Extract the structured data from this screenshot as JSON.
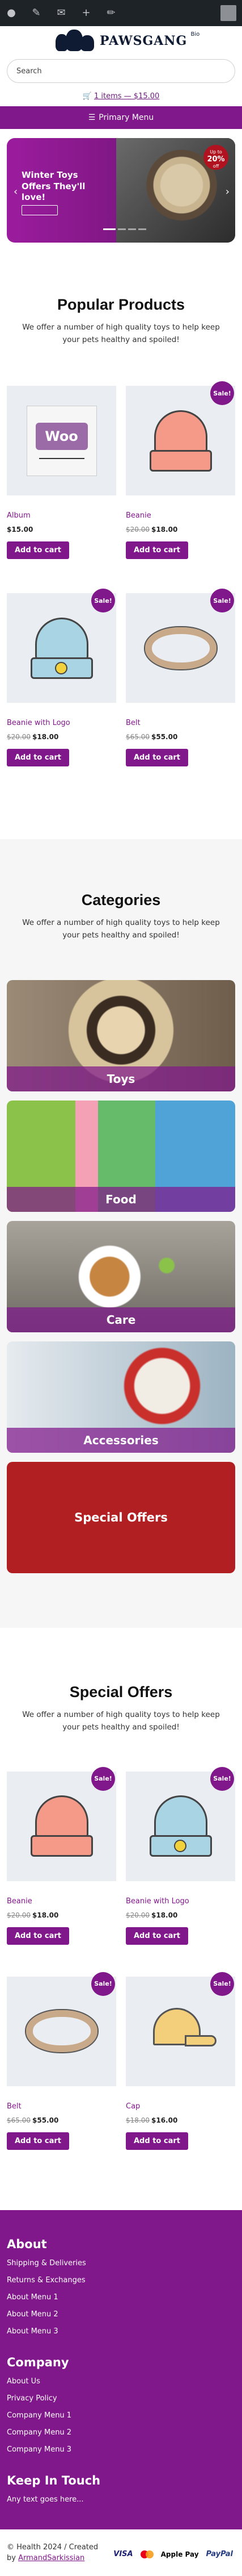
{
  "admin_bar": {
    "icons": [
      "wordpress-icon",
      "paint-brush-icon",
      "comment-icon",
      "plus-icon",
      "pencil-icon"
    ]
  },
  "header": {
    "site_name": "PAWSGANG",
    "site_name_sup": "Bio",
    "search_placeholder": "Search",
    "cart_text": "1 items — $15.00",
    "menu_label": "Primary Menu"
  },
  "hero": {
    "title": "Winter Toys Offers They'll love!",
    "badge_top": "Up to",
    "badge_pct": "20%",
    "badge_bottom": "off"
  },
  "popular": {
    "heading": "Popular Products",
    "lead": "We offer a number of high quality toys to help keep your pets healthy and spoiled!",
    "products": [
      {
        "name": "Album",
        "price": "$15.00",
        "old_price": "",
        "sale": false,
        "button": "Add to cart",
        "image": "woo-album"
      },
      {
        "name": "Beanie",
        "price": "$18.00",
        "old_price": "$20.00",
        "sale": true,
        "button": "Add to cart",
        "image": "beanie-orange"
      },
      {
        "name": "Beanie with Logo",
        "price": "$18.00",
        "old_price": "$20.00",
        "sale": true,
        "button": "Add to cart",
        "image": "beanie-blue"
      },
      {
        "name": "Belt",
        "price": "$55.00",
        "old_price": "$65.00",
        "sale": true,
        "button": "Add to cart",
        "image": "belt"
      }
    ]
  },
  "categories": {
    "heading": "Categories",
    "lead": "We offer a number of high quality toys to help keep your pets healthy and spoiled!",
    "items": [
      {
        "label": "Toys",
        "photo": "pug-photo"
      },
      {
        "label": "Food",
        "photo": "food-bags-photo"
      },
      {
        "label": "Care",
        "photo": "dog-with-ball-photo"
      },
      {
        "label": "Accessories",
        "photo": "bulldog-bandana-photo"
      },
      {
        "label": "Special Offers",
        "photo": "special-offers-red"
      }
    ]
  },
  "special": {
    "heading": "Special Offers",
    "lead": "We offer a number of high quality toys to help keep your pets healthy and spoiled!",
    "products": [
      {
        "name": "Beanie",
        "price": "$18.00",
        "old_price": "$20.00",
        "sale": true,
        "button": "Add to cart",
        "image": "beanie-orange"
      },
      {
        "name": "Beanie with Logo",
        "price": "$18.00",
        "old_price": "$20.00",
        "sale": true,
        "button": "Add to cart",
        "image": "beanie-blue"
      },
      {
        "name": "Belt",
        "price": "$55.00",
        "old_price": "$65.00",
        "sale": true,
        "button": "Add to cart",
        "image": "belt"
      },
      {
        "name": "Cap",
        "price": "$16.00",
        "old_price": "$18.00",
        "sale": true,
        "button": "Add to cart",
        "image": "cap"
      }
    ]
  },
  "footer": {
    "about": {
      "heading": "About",
      "links": [
        "Shipping & Deliveries",
        "Returns & Exchanges",
        "About Menu 1",
        "About Menu 2",
        "About Menu 3"
      ]
    },
    "company": {
      "heading": "Company",
      "links": [
        "About Us",
        "Privacy Policy",
        "Company Menu 1",
        "Company Menu 2",
        "Company Menu 3"
      ]
    },
    "keep_in_touch": {
      "heading": "Keep In Touch",
      "text": "Any text goes here..."
    }
  },
  "bottom": {
    "copyright": "© Health 2024 / Created",
    "by": "by",
    "author": "ArmandSarkissian",
    "payment_methods": [
      "VISA",
      "mastercard",
      "Apple Pay",
      "PayPal"
    ]
  },
  "colors": {
    "brand_purple": "#80178a",
    "admin_bar": "#1d2327",
    "sale_red": "#b21f22"
  }
}
